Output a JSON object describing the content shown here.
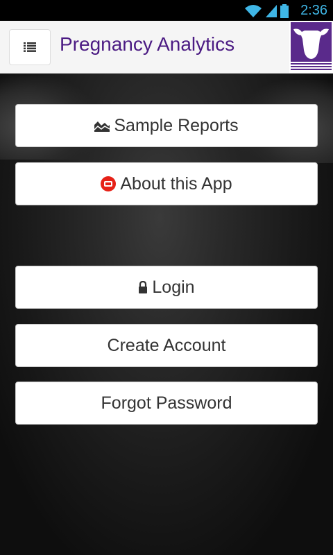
{
  "status_bar": {
    "time": "2:36",
    "icons": [
      "wifi-icon",
      "signal-icon",
      "battery-icon"
    ]
  },
  "app_bar": {
    "title": "Pregnancy Analytics",
    "menu_icon": "list-icon",
    "logo": "cow-logo"
  },
  "buttons": {
    "sample_reports": "Sample Reports",
    "about": "About this App",
    "login": "Login",
    "create_account": "Create Account",
    "forgot_password": "Forgot Password"
  },
  "colors": {
    "title": "#4b1b83",
    "brand": "#5a2a8b",
    "status_accent": "#3fb6e6",
    "youtube_red": "#e62117"
  }
}
